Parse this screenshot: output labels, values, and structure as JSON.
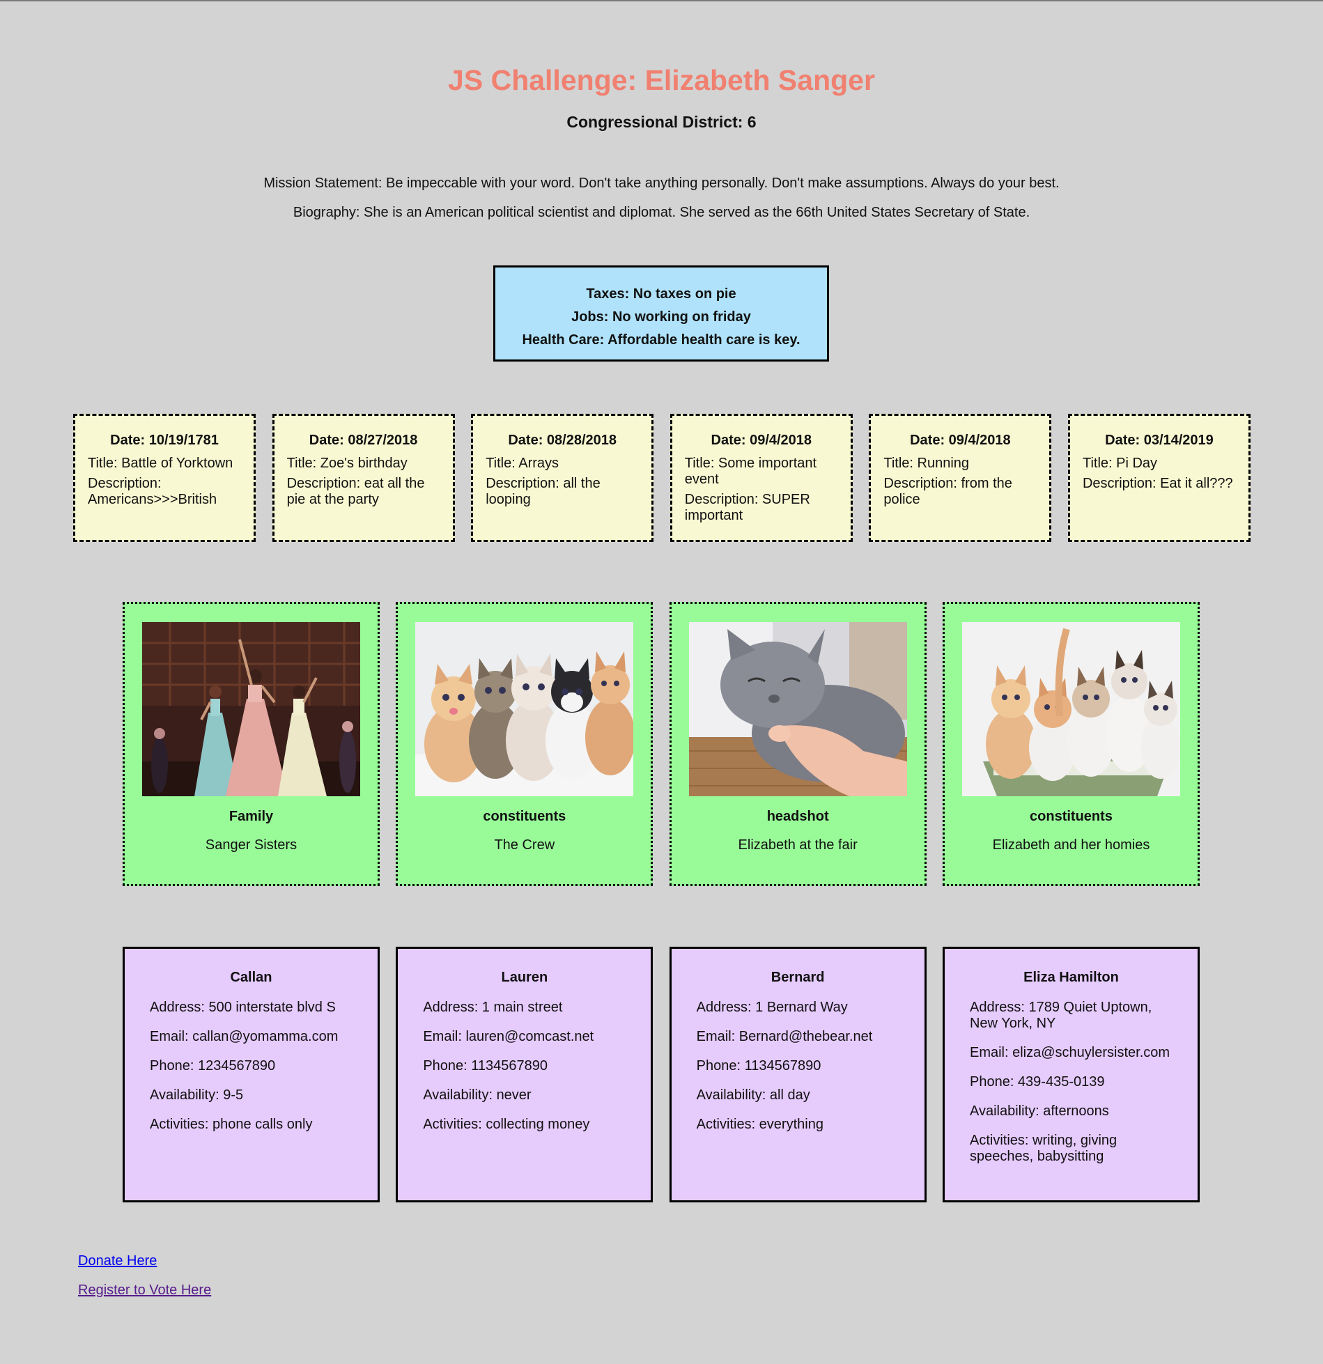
{
  "header": {
    "title": "JS Challenge: Elizabeth Sanger",
    "district": "Congressional District: 6",
    "mission": "Mission Statement: Be impeccable with your word. Don't take anything personally. Don't make assumptions. Always do your best.",
    "biography": "Biography: She is an American political scientist and diplomat. She served as the 66th United States Secretary of State."
  },
  "platform": {
    "taxes": "Taxes: No taxes on pie",
    "jobs": "Jobs: No working on friday",
    "health_care": "Health Care: Affordable health care is key."
  },
  "events": [
    {
      "date": "Date: 10/19/1781",
      "title": "Title: Battle of Yorktown",
      "description": "Description: Americans>>>British"
    },
    {
      "date": "Date: 08/27/2018",
      "title": "Title: Zoe's birthday",
      "description": "Description: eat all the pie at the party"
    },
    {
      "date": "Date: 08/28/2018",
      "title": "Title: Arrays",
      "description": "Description: all the looping"
    },
    {
      "date": "Date: 09/4/2018",
      "title": "Title: Some important event",
      "description": "Description: SUPER important"
    },
    {
      "date": "Date: 09/4/2018",
      "title": "Title: Running",
      "description": "Description: from the police"
    },
    {
      "date": "Date: 03/14/2019",
      "title": "Title: Pi Day",
      "description": "Description: Eat it all???"
    }
  ],
  "photos": [
    {
      "type": "Family",
      "caption": "Sanger Sisters",
      "image": "stage-performance-photo"
    },
    {
      "type": "constituents",
      "caption": "The Crew",
      "image": "kittens-photo"
    },
    {
      "type": "headshot",
      "caption": "Elizabeth at the fair",
      "image": "gray-cat-photo"
    },
    {
      "type": "constituents",
      "caption": "Elizabeth and her homies",
      "image": "kittens-in-basket-photo"
    }
  ],
  "volunteers": [
    {
      "name": "Callan",
      "address": "Address: 500 interstate blvd S",
      "email": "Email: callan@yomamma.com",
      "phone": "Phone: 1234567890",
      "availability": "Availability: 9-5",
      "activities": "Activities: phone calls only"
    },
    {
      "name": "Lauren",
      "address": "Address: 1 main street",
      "email": "Email: lauren@comcast.net",
      "phone": "Phone: 1134567890",
      "availability": "Availability: never",
      "activities": "Activities: collecting money"
    },
    {
      "name": "Bernard",
      "address": "Address: 1 Bernard Way",
      "email": "Email: Bernard@thebear.net",
      "phone": "Phone: 1134567890",
      "availability": "Availability: all day",
      "activities": "Activities: everything"
    },
    {
      "name": "Eliza Hamilton",
      "address": "Address: 1789 Quiet Uptown, New York, NY",
      "email": "Email: eliza@schuylersister.com",
      "phone": "Phone: 439-435-0139",
      "availability": "Availability: afternoons",
      "activities": "Activities: writing, giving speeches, babysitting"
    }
  ],
  "links": {
    "donate": "Donate Here",
    "register": "Register to Vote Here"
  },
  "colors": {
    "background": "#d3d3d3",
    "title": "#f08070",
    "platform_bg": "#b0e3fb",
    "event_bg": "#f8f8d2",
    "photo_bg": "#98fb98",
    "volunteer_bg": "#e6cbfd",
    "link": "#0000ee",
    "visited_link": "#551a8b"
  }
}
